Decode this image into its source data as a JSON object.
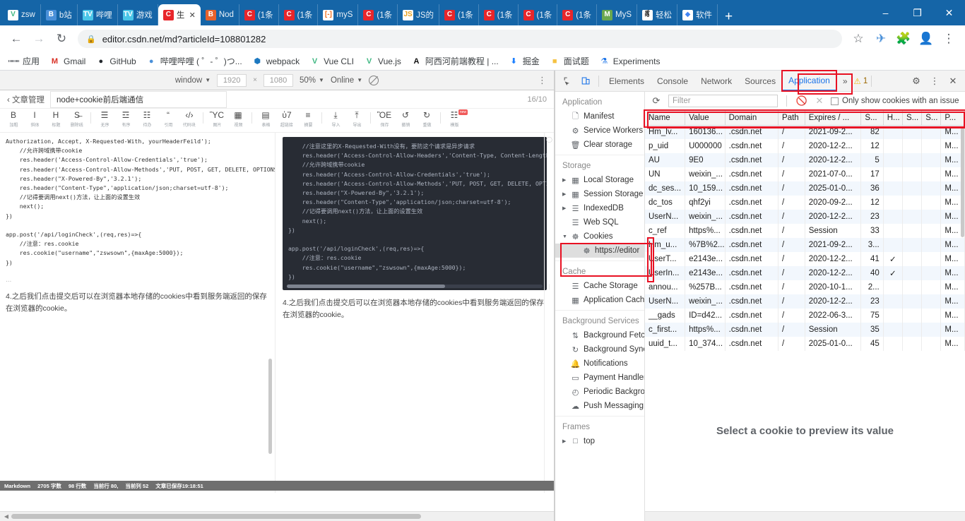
{
  "browser": {
    "tabs": [
      {
        "label": "zsw",
        "icon": "V",
        "icon_bg": "#ffffff",
        "icon_color": "#41b883",
        "active": false
      },
      {
        "label": "b站",
        "icon": "B",
        "icon_bg": "#4a90d9",
        "icon_color": "#ffffff",
        "active": false
      },
      {
        "label": "哔哩",
        "icon": "TV",
        "icon_bg": "#4ac6e8",
        "icon_color": "#ffffff",
        "active": false
      },
      {
        "label": "游戏",
        "icon": "TV",
        "icon_bg": "#4ac6e8",
        "icon_color": "#ffffff",
        "active": false
      },
      {
        "label": "生",
        "icon": "C",
        "icon_bg": "#e8262b",
        "icon_color": "#ffffff",
        "active": true
      },
      {
        "label": "Nod",
        "icon": "B",
        "icon_bg": "#e8622b",
        "icon_color": "#ffffff",
        "active": false
      },
      {
        "label": "(1条",
        "icon": "C",
        "icon_bg": "#e8262b",
        "icon_color": "#ffffff",
        "active": false
      },
      {
        "label": "(1条",
        "icon": "C",
        "icon_bg": "#e8262b",
        "icon_color": "#ffffff",
        "active": false
      },
      {
        "label": "myS",
        "icon": "[-]",
        "icon_bg": "#ffffff",
        "icon_color": "#f07020",
        "active": false
      },
      {
        "label": "(1条",
        "icon": "C",
        "icon_bg": "#e8262b",
        "icon_color": "#ffffff",
        "active": false
      },
      {
        "label": "JS的",
        "icon": "JS",
        "icon_bg": "#ffffff",
        "icon_color": "#e8a020",
        "active": false
      },
      {
        "label": "(1条",
        "icon": "C",
        "icon_bg": "#e8262b",
        "icon_color": "#ffffff",
        "active": false
      },
      {
        "label": "(1条",
        "icon": "C",
        "icon_bg": "#e8262b",
        "icon_color": "#ffffff",
        "active": false
      },
      {
        "label": "(1条",
        "icon": "C",
        "icon_bg": "#e8262b",
        "icon_color": "#ffffff",
        "active": false
      },
      {
        "label": "(1条",
        "icon": "C",
        "icon_bg": "#e8262b",
        "icon_color": "#ffffff",
        "active": false
      },
      {
        "label": "MyS",
        "icon": "M",
        "icon_bg": "#6aa84f",
        "icon_color": "#ffffff",
        "active": false
      },
      {
        "label": "轻松",
        "icon": "豸",
        "icon_bg": "#ffffff",
        "icon_color": "#222222",
        "active": false
      },
      {
        "label": "软件",
        "icon": "◆",
        "icon_bg": "#ffffff",
        "icon_color": "#4285f4",
        "active": false
      }
    ],
    "new_tab_label": "+",
    "window_controls": {
      "minimize": "–",
      "maximize": "❐",
      "close": "✕"
    },
    "nav": {
      "back": "←",
      "forward": "→",
      "reload": "↻",
      "lock_icon": "🔒",
      "url": "editor.csdn.net/md?articleId=108801282",
      "star": "☆",
      "ext1": "✈",
      "ext2": "🧩",
      "profile": "👤",
      "menu": "⋮"
    },
    "bookmarks": [
      {
        "label": "应用",
        "icon": "grid"
      },
      {
        "label": "Gmail",
        "icon": "M",
        "color": "#d93025"
      },
      {
        "label": "GitHub",
        "icon": "●",
        "color": "#24292e"
      },
      {
        "label": "哔哩哔哩 ( ゜- ゜)つ...",
        "icon": "●",
        "color": "#4a90d9"
      },
      {
        "label": "webpack",
        "icon": "⬢",
        "color": "#1c78c0"
      },
      {
        "label": "Vue CLI",
        "icon": "V",
        "color": "#41b883"
      },
      {
        "label": "Vue.js",
        "icon": "V",
        "color": "#41b883"
      },
      {
        "label": "阿西河前端教程 | ...",
        "icon": "A",
        "color": "#111111"
      },
      {
        "label": "掘金",
        "icon": "⬇",
        "color": "#1e80ff"
      },
      {
        "label": "面试题",
        "icon": "■",
        "color": "#f5c242"
      },
      {
        "label": "Experiments",
        "icon": "⚗",
        "color": "#1a73e8"
      }
    ]
  },
  "device_bar": {
    "device": "window",
    "width": "1920",
    "height": "1080",
    "separator": "×",
    "zoom": "50%",
    "network": "Online",
    "throttle_icon": "no-throttle-icon",
    "more": "⋮"
  },
  "editor": {
    "back_label": "‹ 文章管理",
    "title": "node+cookie前后端通信",
    "word_counter": "16/10",
    "toolbar": [
      {
        "glyph": "B",
        "label": "加粗"
      },
      {
        "glyph": "I",
        "label": "斜体"
      },
      {
        "glyph": "H",
        "label": "标题"
      },
      {
        "glyph": "S̶",
        "label": "删除线"
      },
      {
        "sep": true
      },
      {
        "glyph": "☰",
        "label": "无序"
      },
      {
        "glyph": "☲",
        "label": "有序"
      },
      {
        "glyph": "☷",
        "label": "待办"
      },
      {
        "glyph": "“",
        "label": "引用"
      },
      {
        "glyph": "‹/›",
        "label": "代码块"
      },
      {
        "sep": true
      },
      {
        "glyph": "ὛC",
        "label": "图片"
      },
      {
        "glyph": "▦",
        "label": "视频"
      },
      {
        "sep": true
      },
      {
        "glyph": "▤",
        "label": "表格"
      },
      {
        "glyph": "ὑ7",
        "label": "超链接"
      },
      {
        "glyph": "≡",
        "label": "摘要"
      },
      {
        "sep": true
      },
      {
        "glyph": "⤓",
        "label": "导入"
      },
      {
        "glyph": "⤒",
        "label": "导出"
      },
      {
        "sep": true
      },
      {
        "glyph": "ὋE",
        "label": "保存"
      },
      {
        "glyph": "↺",
        "label": "撤销"
      },
      {
        "glyph": "↻",
        "label": "重做"
      },
      {
        "sep": true
      },
      {
        "glyph": "☷",
        "label": "模版",
        "badge": "new"
      }
    ],
    "source_code": "Authorization, Accept, X-Requested-With, yourHeaderFeild');\n    //允许跨域携带cookie\n    res.header('Access-Control-Allow-Credentials','true');\n    res.header('Access-Control-Allow-Methods','PUT, POST, GET, DELETE, OPTIONS');\n    res.header(\"X-Powered-By\",'3.2.1');\n    res.header(\"Content-Type\",'application/json;charset=utf-8');\n    //记得要调用next()方法，让上面的设置生效\n    next();\n})\n\napp.post('/api/loginCheck',(req,res)=>{\n    //注意：res.cookie\n    res.cookie(\"username\",\"zswsown\",{maxAge:5000});\n})",
    "source_dots": "...",
    "source_paragraph": "4.之后我们点击提交后可以在浏览器本地存储的cookies中看到服务端返回的保存在浏览器的cookie。",
    "preview_code": "    //注意这里的X-Requested-With没有，要防这个请求是异步请求\n    res.header('Access-Control-Allow-Headers','Content-Type, Content-Length, Authoriza\n    //允许跨域携带cookie\n    res.header('Access-Control-Allow-Credentials','true');\n    res.header('Access-Control-Allow-Methods','PUT, POST, GET, DELETE, OPTIONS');\n    res.header(\"X-Powered-By\",'3.2.1');\n    res.header(\"Content-Type\",'application/json;charset=utf-8');\n    //记得要调用next()方法，让上面的设置生效\n    next();\n})\n\napp.post('/api/loginCheck',(req,res)=>{\n    //注意：res.cookie\n    res.cookie(\"username\",\"zswsown\",{maxAge:5000});\n})",
    "preview_paragraph": "4.之后我们点击提交后可以在浏览器本地存储的cookies中看到服务端返回的保存在浏览器的cookie。",
    "status": {
      "format": "Markdown",
      "chars_label": "2705 字数",
      "lines_label": "98 行数",
      "cursor_line": "当前行 80,",
      "cursor_col": "当前列 52",
      "saved": "文章已保存19:18:51"
    }
  },
  "devtools": {
    "inspect_icon": "inspect-icon",
    "device_icon": "device-toolbar-icon",
    "tabs": [
      {
        "label": "Elements",
        "active": false
      },
      {
        "label": "Console",
        "active": false
      },
      {
        "label": "Network",
        "active": false
      },
      {
        "label": "Sources",
        "active": false
      },
      {
        "label": "Application",
        "active": true
      }
    ],
    "more_tabs": "»",
    "warning_icon": "warning-icon",
    "warning_count": "1",
    "settings_icon": "gear-icon",
    "kebab_icon": "more-vertical-icon",
    "close_icon": "close-icon",
    "sidebar": {
      "groups": [
        {
          "title": "Application",
          "items": [
            {
              "label": "Manifest",
              "icon": "document-icon"
            },
            {
              "label": "Service Workers",
              "icon": "gear-icon"
            },
            {
              "label": "Clear storage",
              "icon": "trash-icon"
            }
          ]
        },
        {
          "title": "Storage",
          "items": [
            {
              "label": "Local Storage",
              "icon": "storage-icon",
              "twisty": "▶"
            },
            {
              "label": "Session Storage",
              "icon": "storage-icon",
              "twisty": "▶"
            },
            {
              "label": "IndexedDB",
              "icon": "database-icon",
              "twisty": "▶"
            },
            {
              "label": "Web SQL",
              "icon": "database-icon"
            },
            {
              "label": "Cookies",
              "icon": "cookie-icon",
              "twisty": "▼",
              "expanded": true
            },
            {
              "label": "https://editor",
              "icon": "cookie-icon",
              "sub": true,
              "selected": true
            }
          ]
        },
        {
          "title": "Cache",
          "items": [
            {
              "label": "Cache Storage",
              "icon": "database-icon"
            },
            {
              "label": "Application Cache",
              "icon": "storage-icon"
            }
          ]
        },
        {
          "title": "Background Services",
          "items": [
            {
              "label": "Background Fetch",
              "icon": "updown-arrow-icon"
            },
            {
              "label": "Background Sync",
              "icon": "sync-icon"
            },
            {
              "label": "Notifications",
              "icon": "bell-icon"
            },
            {
              "label": "Payment Handler",
              "icon": "card-icon"
            },
            {
              "label": "Periodic Background Sync",
              "icon": "clock-icon"
            },
            {
              "label": "Push Messaging",
              "icon": "cloud-icon"
            }
          ]
        },
        {
          "title": "Frames",
          "items": [
            {
              "label": "top",
              "icon": "frame-icon",
              "twisty": "▶"
            }
          ]
        }
      ]
    },
    "cookie_toolbar": {
      "refresh_icon": "refresh-icon",
      "filter_placeholder": "Filter",
      "clear_icon": "clear-all-icon",
      "delete_icon": "delete-icon",
      "issue_checkbox_label": "Only show cookies with an issue",
      "issue_checked": false
    },
    "cookie_table": {
      "columns": [
        "Name",
        "Value",
        "Domain",
        "Path",
        "Expires / ...",
        "S...",
        "H...",
        "S...",
        "S...",
        "P..."
      ],
      "rows": [
        {
          "name": "Hm_lv...",
          "value": "160136...",
          "domain": ".csdn.net",
          "path": "/",
          "expires": "2021-09-2...",
          "size": "82",
          "http": "",
          "secure": "",
          "samesite": "",
          "priority": "M...",
          "clipped": true
        },
        {
          "name": "p_uid",
          "value": "U000000",
          "domain": ".csdn.net",
          "path": "/",
          "expires": "2020-12-2...",
          "size": "12",
          "http": "",
          "secure": "",
          "samesite": "",
          "priority": "M..."
        },
        {
          "name": "AU",
          "value": "9E0",
          "domain": ".csdn.net",
          "path": "/",
          "expires": "2020-12-2...",
          "size": "5",
          "http": "",
          "secure": "",
          "samesite": "",
          "priority": "M..."
        },
        {
          "name": "UN",
          "value": "weixin_...",
          "domain": ".csdn.net",
          "path": "/",
          "expires": "2021-07-0...",
          "size": "17",
          "http": "",
          "secure": "",
          "samesite": "",
          "priority": "M..."
        },
        {
          "name": "dc_ses...",
          "value": "10_159...",
          "domain": ".csdn.net",
          "path": "/",
          "expires": "2025-01-0...",
          "size": "36",
          "http": "",
          "secure": "",
          "samesite": "",
          "priority": "M..."
        },
        {
          "name": "dc_tos",
          "value": "qhf2yi",
          "domain": ".csdn.net",
          "path": "/",
          "expires": "2020-09-2...",
          "size": "12",
          "http": "",
          "secure": "",
          "samesite": "",
          "priority": "M..."
        },
        {
          "name": "UserN...",
          "value": "weixin_...",
          "domain": ".csdn.net",
          "path": "/",
          "expires": "2020-12-2...",
          "size": "23",
          "http": "",
          "secure": "",
          "samesite": "",
          "priority": "M..."
        },
        {
          "name": "c_ref",
          "value": "https%...",
          "domain": ".csdn.net",
          "path": "/",
          "expires": "Session",
          "size": "33",
          "http": "",
          "secure": "",
          "samesite": "",
          "priority": "M..."
        },
        {
          "name": "Hm_u...",
          "value": "%7B%2...",
          "domain": ".csdn.net",
          "path": "/",
          "expires": "2021-09-2...",
          "size": "3...",
          "http": "",
          "secure": "",
          "samesite": "",
          "priority": "M..."
        },
        {
          "name": "UserT...",
          "value": "e2143e...",
          "domain": ".csdn.net",
          "path": "/",
          "expires": "2020-12-2...",
          "size": "41",
          "http": "✓",
          "secure": "",
          "samesite": "",
          "priority": "M..."
        },
        {
          "name": "UserIn...",
          "value": "e2143e...",
          "domain": ".csdn.net",
          "path": "/",
          "expires": "2020-12-2...",
          "size": "40",
          "http": "✓",
          "secure": "",
          "samesite": "",
          "priority": "M..."
        },
        {
          "name": "annou...",
          "value": "%257B...",
          "domain": ".csdn.net",
          "path": "/",
          "expires": "2020-10-1...",
          "size": "2...",
          "http": "",
          "secure": "",
          "samesite": "",
          "priority": "M..."
        },
        {
          "name": "UserN...",
          "value": "weixin_...",
          "domain": ".csdn.net",
          "path": "/",
          "expires": "2020-12-2...",
          "size": "23",
          "http": "",
          "secure": "",
          "samesite": "",
          "priority": "M..."
        },
        {
          "name": "__gads",
          "value": "ID=d42...",
          "domain": ".csdn.net",
          "path": "/",
          "expires": "2022-06-3...",
          "size": "75",
          "http": "",
          "secure": "",
          "samesite": "",
          "priority": "M..."
        },
        {
          "name": "c_first...",
          "value": "https%...",
          "domain": ".csdn.net",
          "path": "/",
          "expires": "Session",
          "size": "35",
          "http": "",
          "secure": "",
          "samesite": "",
          "priority": "M..."
        },
        {
          "name": "uuid_t...",
          "value": "10_374...",
          "domain": ".csdn.net",
          "path": "/",
          "expires": "2025-01-0...",
          "size": "45",
          "http": "",
          "secure": "",
          "samesite": "",
          "priority": "M..."
        }
      ]
    },
    "preview_placeholder": "Select a cookie to preview its value"
  },
  "colors": {
    "chrome_blue": "#1565a7",
    "devtools_accent": "#1a73e8",
    "highlight_red": "#e81123",
    "code_bg": "#282c34"
  }
}
